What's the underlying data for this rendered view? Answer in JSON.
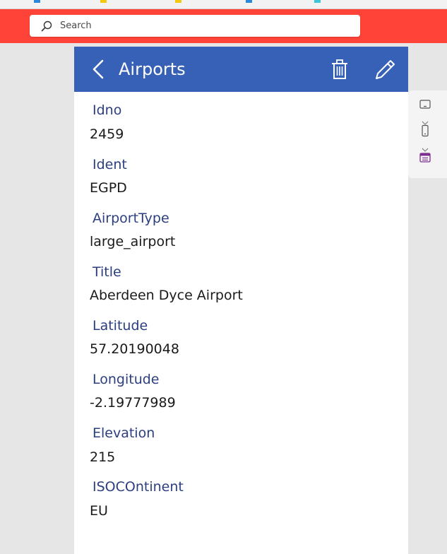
{
  "search": {
    "placeholder": "Search"
  },
  "app": {
    "title": "Airports",
    "fields": [
      {
        "label": "Idno",
        "value": "2459"
      },
      {
        "label": "Ident",
        "value": "EGPD"
      },
      {
        "label": "AirportType",
        "value": "large_airport"
      },
      {
        "label": "Title",
        "value": "Aberdeen Dyce Airport"
      },
      {
        "label": "Latitude",
        "value": "57.20190048"
      },
      {
        "label": "Longitude",
        "value": "-2.19777989"
      },
      {
        "label": "Elevation",
        "value": "215"
      },
      {
        "label": "ISOCOntinent",
        "value": "EU"
      }
    ]
  },
  "colors": {
    "accent_red": "#ff4338",
    "header_blue": "#3761b7",
    "label_blue": "#2b3e80",
    "toolbar_purple": "#7b2e8e"
  },
  "icons": [
    "search-icon",
    "back-chevron-icon",
    "trash-icon",
    "pencil-icon",
    "tablet-icon",
    "phone-icon",
    "form-view-icon"
  ]
}
